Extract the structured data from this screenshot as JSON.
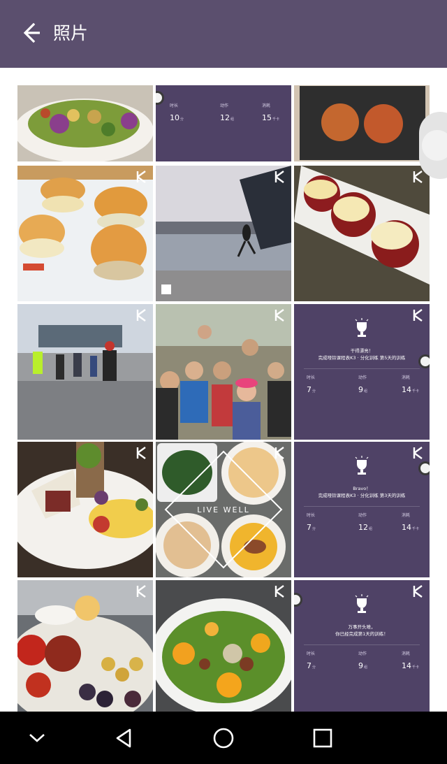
{
  "app": {
    "title": "照片"
  },
  "colors": {
    "topbar": "#5b4f6e",
    "card": "#4f4266",
    "navbar": "#000000"
  },
  "icons": {
    "back": "arrow-left-icon",
    "badge": "keep-k-icon",
    "trophy": "trophy-icon"
  },
  "cards": [
    {
      "id": "card-top",
      "message": "",
      "stats": [
        {
          "label": "时长",
          "value": "10",
          "unit": "分"
        },
        {
          "label": "动作",
          "value": "12",
          "unit": "组"
        },
        {
          "label": "消耗",
          "value": "15",
          "unit": "千卡"
        }
      ]
    },
    {
      "id": "card-1",
      "message": "干得漂亮！\n完成哑铃课程表K3 · 分化训练 第5天的训练",
      "stats": [
        {
          "label": "时长",
          "value": "7",
          "unit": "分"
        },
        {
          "label": "动作",
          "value": "9",
          "unit": "组"
        },
        {
          "label": "消耗",
          "value": "14",
          "unit": "千卡"
        }
      ]
    },
    {
      "id": "card-2",
      "message": "Bravo！\n完成哑铃课程表K3 · 分化训练 第3天的训练",
      "stats": [
        {
          "label": "时长",
          "value": "7",
          "unit": "分"
        },
        {
          "label": "动作",
          "value": "12",
          "unit": "组"
        },
        {
          "label": "消耗",
          "value": "14",
          "unit": "千卡"
        }
      ]
    },
    {
      "id": "card-3",
      "message": "万事开头难，\n你已经完成第1天的训练！",
      "stats": [
        {
          "label": "时长",
          "value": "7",
          "unit": "分"
        },
        {
          "label": "动作",
          "value": "9",
          "unit": "组"
        },
        {
          "label": "消耗",
          "value": "14",
          "unit": "千卡"
        }
      ]
    }
  ],
  "photos": {
    "salad_top": "",
    "cake_top": "",
    "burgers": "",
    "runner": "",
    "cupcakes": "",
    "running_group": "",
    "group_selfie": "",
    "wrap_plate": "",
    "live_well": "LIVE WELL",
    "fruit_bowl": "",
    "orange_salad": ""
  },
  "nav": {
    "items": [
      "hide-keyboard",
      "back",
      "home",
      "recents"
    ]
  }
}
